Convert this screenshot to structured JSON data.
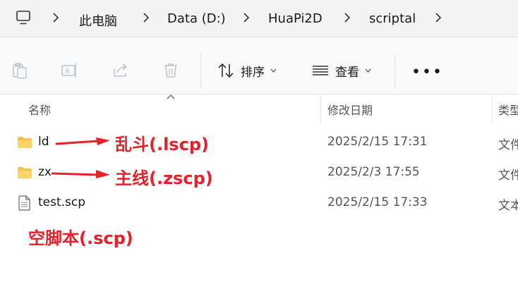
{
  "breadcrumb": {
    "items": [
      "此电脑",
      "Data (D:)",
      "HuaPi2D",
      "scriptal"
    ]
  },
  "toolbar": {
    "sort_label": "排序",
    "view_label": "查看",
    "more_label": "•••"
  },
  "columns": {
    "name": "名称",
    "modified": "修改日期",
    "type": "类型"
  },
  "files": [
    {
      "name": "ld",
      "modified": "2025/2/15 17:31",
      "type": "文件",
      "icon": "folder-icon"
    },
    {
      "name": "zx",
      "modified": "2025/2/3 17:55",
      "type": "文件",
      "icon": "folder-icon"
    },
    {
      "name": "test.scp",
      "modified": "2025/2/15 17:33",
      "type": "文本",
      "icon": "document-icon"
    }
  ],
  "annotations": {
    "ld": "乱斗(.lscp)",
    "zx": "主线(.zscp)",
    "empty": "空脚本(.scp)",
    "color": "#e8202a"
  }
}
